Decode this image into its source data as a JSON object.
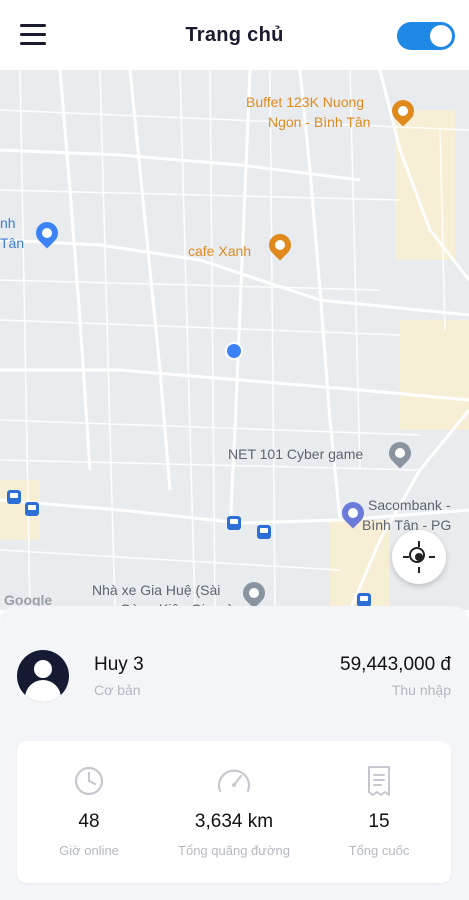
{
  "header": {
    "title": "Trang chủ",
    "toggle_on": true
  },
  "map": {
    "pois": [
      {
        "id": "buffet",
        "line1": "Buffet 123K Nuong",
        "line2": "Ngon - Bình Tân"
      },
      {
        "id": "cafe",
        "line1": "cafe Xanh"
      },
      {
        "id": "net",
        "line1": "NET 101 Cyber game"
      },
      {
        "id": "sacombank",
        "line1": "Sacombank -",
        "line2": "Bình Tân - PG"
      },
      {
        "id": "nhaxe",
        "line1": "Nhà xe Gia Huệ (Sài",
        "line2": "Gòn - Kiên Giang)"
      },
      {
        "id": "left",
        "line1": "nh",
        "line2": "Tân"
      }
    ],
    "attribution": "Google"
  },
  "profile": {
    "name": "Huy 3",
    "tier": "Cơ bản",
    "income": "59,443,000 đ",
    "income_label": "Thu nhập"
  },
  "stats": [
    {
      "icon": "clock-icon",
      "value": "48",
      "label": "Giờ online"
    },
    {
      "icon": "speedometer-icon",
      "value": "3,634 km",
      "label": "Tổng quãng đường"
    },
    {
      "icon": "receipt-icon",
      "value": "15",
      "label": "Tổng cuốc"
    }
  ],
  "colors": {
    "accent": "#1e88e5",
    "poi_orange": "#e08a1e",
    "avatar_bg": "#161a33"
  }
}
